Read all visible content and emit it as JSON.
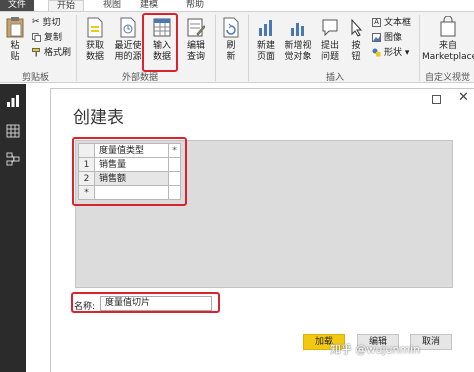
{
  "menubar": {
    "file": "文件",
    "tabs": [
      "开始",
      "视图",
      "建模",
      "帮助"
    ]
  },
  "ribbon": {
    "clipboard": {
      "paste": "粘\n贴",
      "cut": "剪切",
      "copy": "复制",
      "format_painter": "格式刷",
      "group_label": "剪贴板"
    },
    "external": {
      "get_data": "获取\n数据",
      "recent_sources": "最近使\n用的源",
      "enter_data": "输入\n数据",
      "edit_queries": "编辑\n查询",
      "group_label": "外部数据"
    },
    "refresh": "刷\n新",
    "insert": {
      "new_page": "新建\n页面",
      "new_visual": "新增视\n觉对象",
      "ask_question": "提出\n问题",
      "buttons": "按\n钮",
      "textbox": "文本框",
      "image": "图像",
      "shapes": "形状",
      "group_label": "插入"
    },
    "custom": {
      "marketplace": "来自\nMarketplace",
      "group_label": "自定义视觉"
    }
  },
  "icons": {
    "sidebar": [
      "report-icon",
      "data-icon",
      "model-icon"
    ]
  },
  "dialog": {
    "title": "创建表",
    "grid": {
      "header": "度量值类型",
      "star": "*",
      "rows": [
        {
          "num": "1",
          "value": "销售量"
        },
        {
          "num": "2",
          "value": "销售额"
        },
        {
          "num": "*",
          "value": ""
        }
      ]
    },
    "name_label": "名称:",
    "name_value": "度量值切片",
    "buttons": {
      "load": "加载",
      "edit": "编辑",
      "cancel": "取消"
    }
  },
  "watermark": "知乎 @wujunmin",
  "colors": {
    "highlight": "#d9232e",
    "primary_button": "#f2c811",
    "sidebar": "#2b2b2b"
  }
}
